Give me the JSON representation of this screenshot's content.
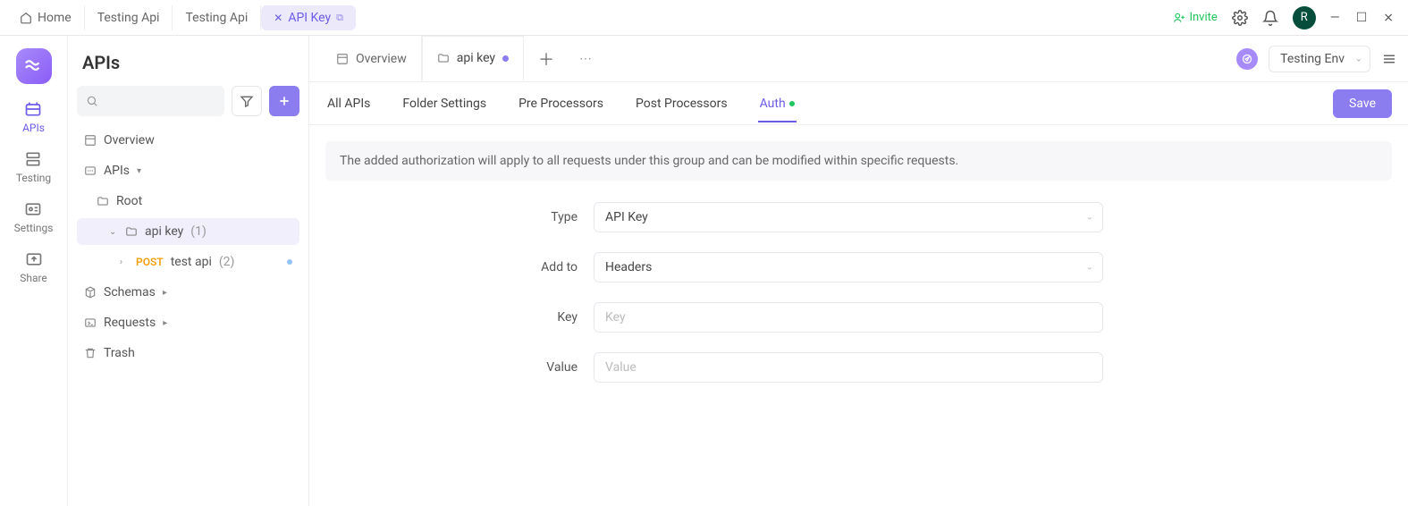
{
  "topTabs": {
    "home": "Home",
    "t1": "Testing Api",
    "t2": "Testing Api",
    "active": "API Key"
  },
  "topRight": {
    "invite": "Invite",
    "avatar": "R"
  },
  "rail": {
    "apis": "APIs",
    "testing": "Testing",
    "settings": "Settings",
    "share": "Share"
  },
  "sidebar": {
    "title": "APIs",
    "overview": "Overview",
    "apis": "APIs",
    "root": "Root",
    "apikey_name": "api key",
    "apikey_count": "(1)",
    "method": "POST",
    "testapi_name": "test api",
    "testapi_count": "(2)",
    "schemas": "Schemas",
    "requests": "Requests",
    "trash": "Trash"
  },
  "docTabs": {
    "overview": "Overview",
    "apikey": "api key"
  },
  "env": {
    "selected": "Testing Env"
  },
  "subTabs": {
    "all": "All APIs",
    "folder": "Folder Settings",
    "pre": "Pre Processors",
    "post": "Post Processors",
    "auth": "Auth",
    "save": "Save"
  },
  "panel": {
    "info": "The added authorization will apply to all requests under this group and can be modified within specific requests.",
    "type_label": "Type",
    "type_value": "API Key",
    "addto_label": "Add to",
    "addto_value": "Headers",
    "key_label": "Key",
    "key_placeholder": "Key",
    "value_label": "Value",
    "value_placeholder": "Value"
  }
}
